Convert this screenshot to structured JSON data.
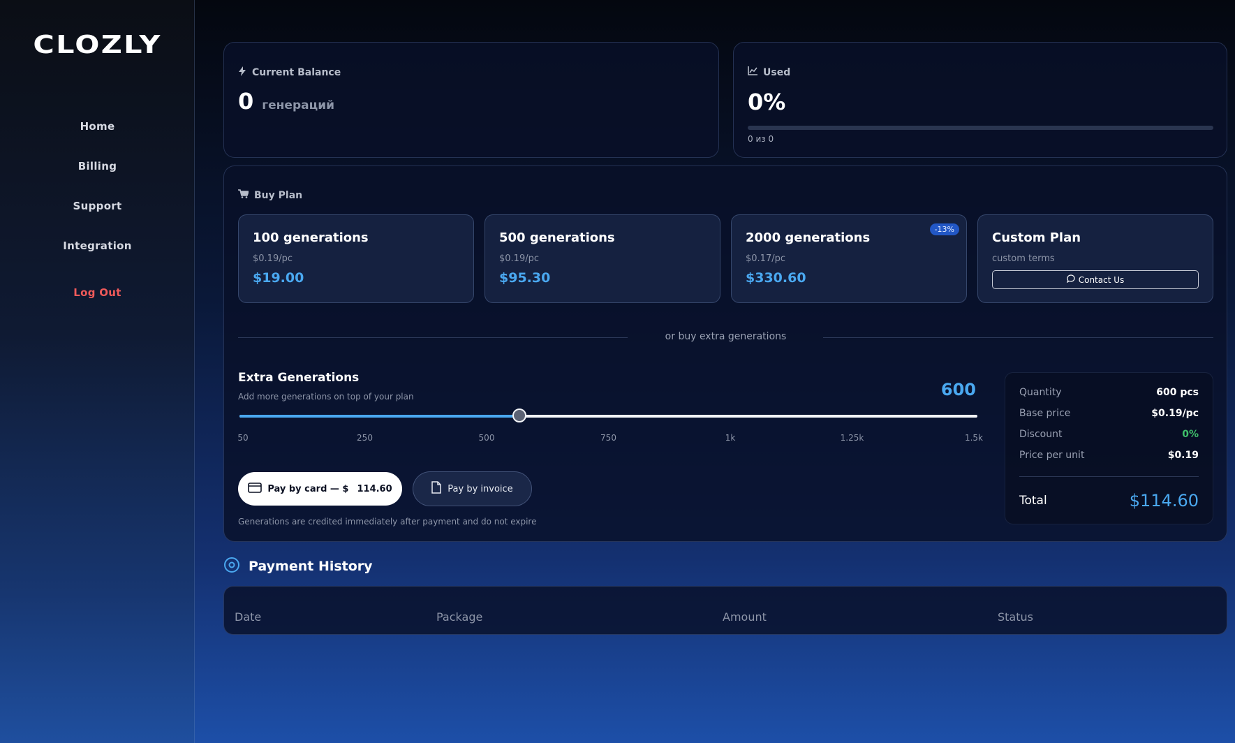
{
  "brand": {
    "logo": "CLOZLY"
  },
  "nav": {
    "items": [
      {
        "label": "Home"
      },
      {
        "label": "Billing"
      },
      {
        "label": "Support"
      },
      {
        "label": "Integration"
      }
    ],
    "logout": "Log Out"
  },
  "balance": {
    "title": "Current Balance",
    "value": "0",
    "unit": "генераций",
    "icon": "bolt-icon"
  },
  "used": {
    "title": "Used",
    "percent": "0%",
    "progress": 0,
    "caption": "0 из 0",
    "icon": "chart-line-icon"
  },
  "buy_plan": {
    "title": "Buy Plan",
    "icon": "cart-icon",
    "plans": [
      {
        "name": "100 generations",
        "per": "$0.19/pc",
        "price": "$19.00"
      },
      {
        "name": "500 generations",
        "per": "$0.19/pc",
        "price": "$95.30"
      },
      {
        "name": "2000 generations",
        "per": "$0.17/pc",
        "price": "$330.60",
        "badge": "-13%"
      }
    ],
    "custom": {
      "name": "Custom Plan",
      "terms": "custom terms",
      "button": "Contact Us"
    },
    "divider_text": "or buy extra generations"
  },
  "extra": {
    "title": "Extra Generations",
    "subtitle": "Add more generations on top of your plan",
    "value": "600",
    "slider": {
      "min": 50,
      "max": 1500,
      "current": 600
    },
    "ticks": [
      "50",
      "250",
      "500",
      "750",
      "1k",
      "1.25k",
      "1.5k"
    ],
    "pay_card": "Pay by card — $",
    "pay_card_amount": "114.60",
    "pay_invoice": "Pay by invoice",
    "note": "Generations are credited immediately after payment and do not expire"
  },
  "summary": {
    "quantity_label": "Quantity",
    "quantity": "600 pcs",
    "base_label": "Base price",
    "base": "$0.19/pc",
    "discount_label": "Discount",
    "discount": "0%",
    "unit_label": "Price per unit",
    "unit": "$0.19",
    "total_label": "Total",
    "total": "$114.60"
  },
  "history": {
    "title": "Payment History",
    "columns": [
      "Date",
      "Package",
      "Amount",
      "Status"
    ]
  },
  "colors": {
    "accent": "#4aa8f0",
    "danger": "#f05a5a",
    "success": "#3fc06a"
  }
}
